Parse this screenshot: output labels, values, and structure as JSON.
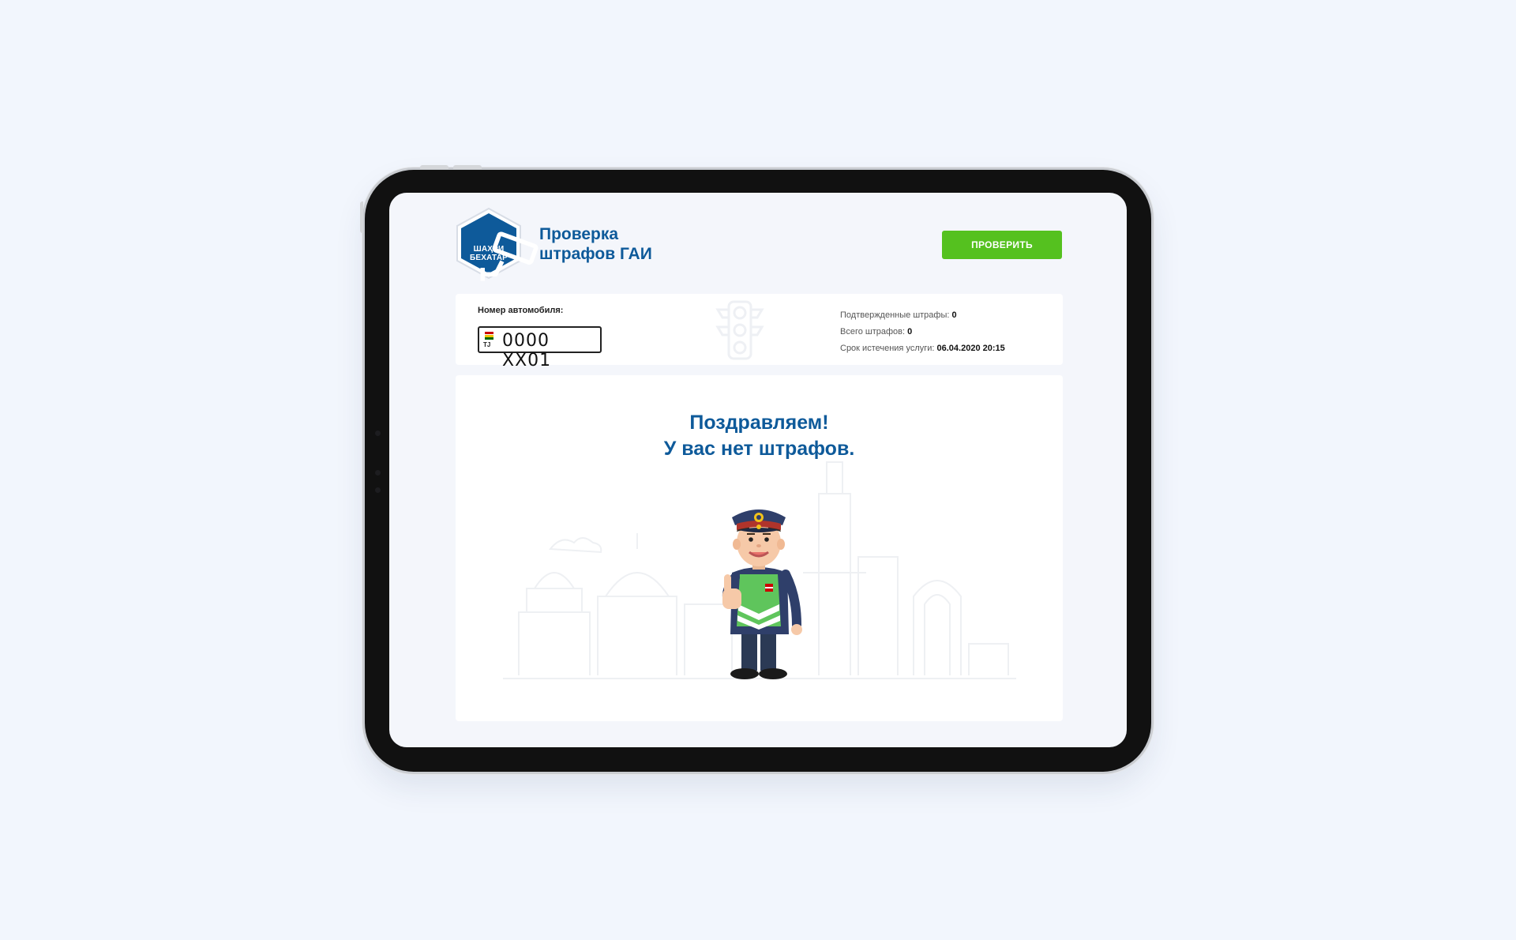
{
  "logo": {
    "line1": "ШАҲРИ",
    "line2": "БЕХАТАР",
    "icon": "security-camera-icon",
    "color": "#0e5a9a"
  },
  "header": {
    "title_line1": "Проверка",
    "title_line2": "штрафов ГАИ",
    "check_button_label": "ПРОВЕРИТЬ",
    "accent_color": "#55c11f"
  },
  "info": {
    "plate_label": "Номер автомобиля:",
    "plate_country": "TJ",
    "plate_number": "0000 XX01",
    "stats": [
      {
        "label": "Подтвержденные штрафы: ",
        "value": "0"
      },
      {
        "label": "Всего штрафов: ",
        "value": "0"
      },
      {
        "label": "Срок истечения услуги: ",
        "value": "06.04.2020 20:15"
      }
    ]
  },
  "result": {
    "title_line1": "Поздравляем!",
    "title_line2": "У вас нет штрафов.",
    "illustration": "traffic-police-officer-thumbs-up"
  }
}
